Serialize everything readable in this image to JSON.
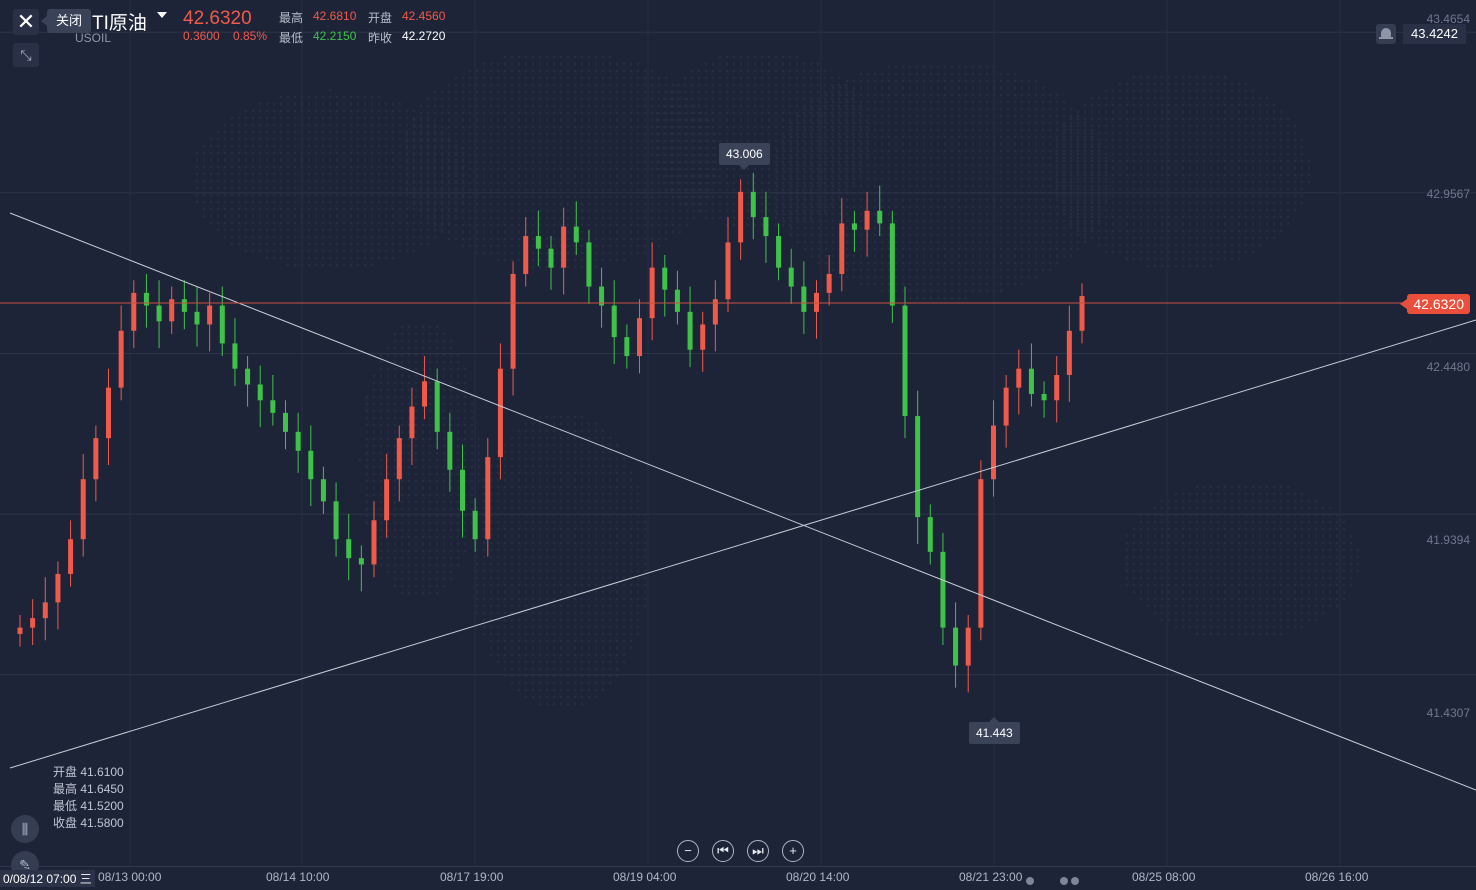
{
  "header": {
    "close_tooltip": "关闭",
    "symbol_name": "TI原油",
    "symbol_code": "USOIL",
    "last_price": "42.6320",
    "change": "0.3600",
    "change_pct": "0.85%",
    "high_label": "最高",
    "high_value": "42.6810",
    "open_label": "开盘",
    "open_value": "42.4560",
    "low_label": "最低",
    "low_value": "42.2150",
    "prev_close_label": "昨收",
    "prev_close_value": "42.2720"
  },
  "alert_price": "43.4242",
  "current_price_badge": "42.6320",
  "price_axis_labels": [
    "43.4654",
    "42.9567",
    "42.4480",
    "41.9394",
    "41.4307"
  ],
  "callouts": {
    "high": "43.006",
    "low": "41.443"
  },
  "ohlc_panel": {
    "open": "开盘 41.6100",
    "high": "最高 41.6450",
    "low": "最低 41.5200",
    "close": "收盘 41.5800"
  },
  "time_axis": {
    "first": "0/08/12 07:00 三",
    "labels": [
      "08/13 00:00",
      "08/14 10:00",
      "08/17 19:00",
      "08/19 04:00",
      "08/20 14:00",
      "08/21 23:00",
      "08/25 08:00",
      "08/26 16:00"
    ]
  },
  "nav_buttons": [
    "−",
    "⏮",
    "⏭",
    "+"
  ],
  "colors": {
    "up": "#f05a4a",
    "down": "#3ec24a",
    "background": "#1e2438",
    "accent": "#ec4e3c"
  },
  "chart_data": {
    "type": "candlestick",
    "y_range": [
      41.24,
      43.52
    ],
    "current_price": 42.632,
    "high_marker": 43.006,
    "low_marker": 41.443,
    "closes": [
      41.58,
      41.61,
      41.66,
      41.75,
      41.86,
      42.05,
      42.18,
      42.34,
      42.52,
      42.64,
      42.6,
      42.55,
      42.62,
      42.58,
      42.54,
      42.6,
      42.48,
      42.4,
      42.35,
      42.3,
      42.26,
      42.2,
      42.14,
      42.05,
      41.98,
      41.86,
      41.8,
      41.78,
      41.92,
      42.05,
      42.18,
      42.28,
      42.36,
      42.2,
      42.08,
      41.95,
      41.86,
      42.12,
      42.4,
      42.7,
      42.82,
      42.78,
      42.72,
      42.85,
      42.8,
      42.66,
      42.6,
      42.5,
      42.44,
      42.56,
      42.72,
      42.65,
      42.58,
      42.46,
      42.54,
      42.62,
      42.8,
      42.96,
      42.88,
      42.82,
      42.72,
      42.66,
      42.58,
      42.64,
      42.7,
      42.86,
      42.84,
      42.9,
      42.86,
      42.6,
      42.25,
      41.93,
      41.82,
      41.58,
      41.46,
      41.58,
      42.05,
      42.22,
      42.34,
      42.4,
      42.32,
      42.3,
      42.38,
      42.52,
      42.63
    ]
  }
}
